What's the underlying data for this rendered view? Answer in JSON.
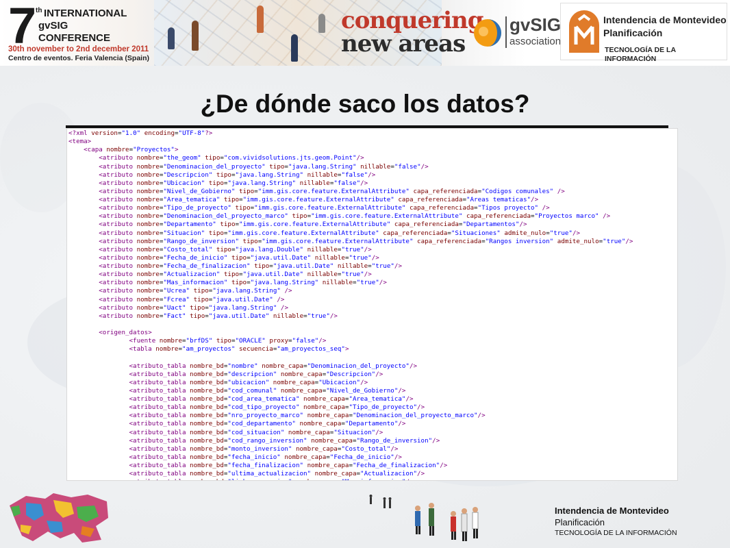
{
  "header": {
    "conference_number": "7",
    "conference_ordinal": "th",
    "conference_lines": [
      "INTERNATIONAL",
      "gvSIG",
      "CONFERENCE"
    ],
    "conference_dates": "30th november to 2nd december 2011",
    "conference_venue": "Centro de eventos. Feria Valencia (Spain)",
    "slogan_line1": "conquering",
    "slogan_line2": "new areas",
    "association_name": "gvSIG",
    "association_sub": "association",
    "org_title": "Intendencia de Montevideo",
    "org_subtitle": "Planificación",
    "org_department": "TECNOLOGÍA DE LA INFORMACIÓN"
  },
  "slide": {
    "title": "¿De dónde saco los datos?"
  },
  "code": {
    "lines": [
      "<?xml version=\"1.0\" encoding=\"UTF-8\"?>",
      "<tema>",
      "    <capa nombre=\"Proyectos\">",
      "        <atributo nombre=\"the_geom\" tipo=\"com.vividsolutions.jts.geom.Point\"/>",
      "        <atributo nombre=\"Denominacion_del_proyecto\" tipo=\"java.lang.String\" nillable=\"false\"/>",
      "        <atributo nombre=\"Descripcion\" tipo=\"java.lang.String\" nillable=\"false\"/>",
      "        <atributo nombre=\"Ubicacion\" tipo=\"java.lang.String\" nillable=\"false\"/>",
      "        <atributo nombre=\"Nivel_de_Gobierno\" tipo=\"imm.gis.core.feature.ExternalAttribute\" capa_referenciada=\"Codigos comunales\" />",
      "        <atributo nombre=\"Area_tematica\" tipo=\"imm.gis.core.feature.ExternalAttribute\" capa_referenciada=\"Areas tematicas\"/>",
      "        <atributo nombre=\"Tipo_de_proyecto\" tipo=\"imm.gis.core.feature.ExternalAttribute\" capa_referenciada=\"Tipos proyecto\" />",
      "        <atributo nombre=\"Denominacion_del_proyecto_marco\" tipo=\"imm.gis.core.feature.ExternalAttribute\" capa_referenciada=\"Proyectos marco\" />",
      "        <atributo nombre=\"Departamento\" tipo=\"imm.gis.core.feature.ExternalAttribute\" capa_referenciada=\"Departamentos\"/>",
      "        <atributo nombre=\"Situacion\" tipo=\"imm.gis.core.feature.ExternalAttribute\" capa_referenciada=\"Situaciones\" admite_nulo=\"true\"/>",
      "        <atributo nombre=\"Rango_de_inversion\" tipo=\"imm.gis.core.feature.ExternalAttribute\" capa_referenciada=\"Rangos inversion\" admite_nulo=\"true\"/>",
      "        <atributo nombre=\"Costo_total\" tipo=\"java.lang.Double\" nillable=\"true\"/>",
      "        <atributo nombre=\"Fecha_de_inicio\" tipo=\"java.util.Date\" nillable=\"true\"/>",
      "        <atributo nombre=\"Fecha_de_finalizacion\" tipo=\"java.util.Date\" nillable=\"true\"/>",
      "        <atributo nombre=\"Actualizacion\" tipo=\"java.util.Date\" nillable=\"true\"/>",
      "        <atributo nombre=\"Mas_informacion\" tipo=\"java.lang.String\" nillable=\"true\"/>",
      "        <atributo nombre=\"Ucrea\" tipo=\"java.lang.String\" />",
      "        <atributo nombre=\"Fcrea\" tipo=\"java.util.Date\" />",
      "        <atributo nombre=\"Uact\" tipo=\"java.lang.String\" />",
      "        <atributo nombre=\"Fact\" tipo=\"java.util.Date\" nillable=\"true\"/>",
      "",
      "        <origen_datos>",
      "                <fuente nombre=\"brfDS\" tipo=\"ORACLE\" proxy=\"false\"/>",
      "                <tabla nombre=\"am_proyectos\" secuencia=\"am_proyectos_seq\">",
      "",
      "                <atributo_tabla nombre_bd=\"nombre\" nombre_capa=\"Denominacion_del_proyecto\"/>",
      "                <atributo_tabla nombre_bd=\"descripcion\" nombre_capa=\"Descripcion\"/>",
      "                <atributo_tabla nombre_bd=\"ubicacion\" nombre_capa=\"Ubicacion\"/>",
      "                <atributo_tabla nombre_bd=\"cod_comunal\" nombre_capa=\"Nivel_de_Gobierno\"/>",
      "                <atributo_tabla nombre_bd=\"cod_area_tematica\" nombre_capa=\"Area_tematica\"/>",
      "                <atributo_tabla nombre_bd=\"cod_tipo_proyecto\" nombre_capa=\"Tipo_de_proyecto\"/>",
      "                <atributo_tabla nombre_bd=\"nro_proyecto_marco\" nombre_capa=\"Denominacion_del_proyecto_marco\"/>",
      "                <atributo_tabla nombre_bd=\"cod_departamento\" nombre_capa=\"Departamento\"/>",
      "                <atributo_tabla nombre_bd=\"cod_situacion\" nombre_capa=\"Situacion\"/>",
      "                <atributo_tabla nombre_bd=\"cod_rango_inversion\" nombre_capa=\"Rango_de_inversion\"/>",
      "                <atributo_tabla nombre_bd=\"monto_inversion\" nombre_capa=\"Costo_total\"/>",
      "                <atributo_tabla nombre_bd=\"fecha_inicio\" nombre_capa=\"Fecha_de_inicio\"/>",
      "                <atributo_tabla nombre_bd=\"fecha_finalizacion\" nombre_capa=\"Fecha_de_finalizacion\"/>",
      "                <atributo_tabla nombre_bd=\"ultima_actualizacion\" nombre_capa=\"Actualizacion\"/>",
      "                <atributo_tabla nombre_bd=\"link_ver_pagina\" nombre_capa=\"Mas_informacion\"/>"
    ],
    "colors": {
      "tag": "#800080",
      "attr_name": "#7a0000",
      "attr_value": "#0000ff",
      "punct": "#000000"
    }
  },
  "footer": {
    "org_title": "Intendencia de Montevideo",
    "org_subtitle": "Planificación",
    "org_department": "TECNOLOGÍA DE LA INFORMACIÓN"
  },
  "colors": {
    "brand_red": "#c0392b",
    "imm_orange": "#e07b2a",
    "gvsig_orange": "#f39c12",
    "gvsig_blue": "#2a6fb5"
  },
  "icons": [
    "imm-logo-icon",
    "gvsig-logo-icon",
    "world-map-icon",
    "people-figures-icon"
  ]
}
